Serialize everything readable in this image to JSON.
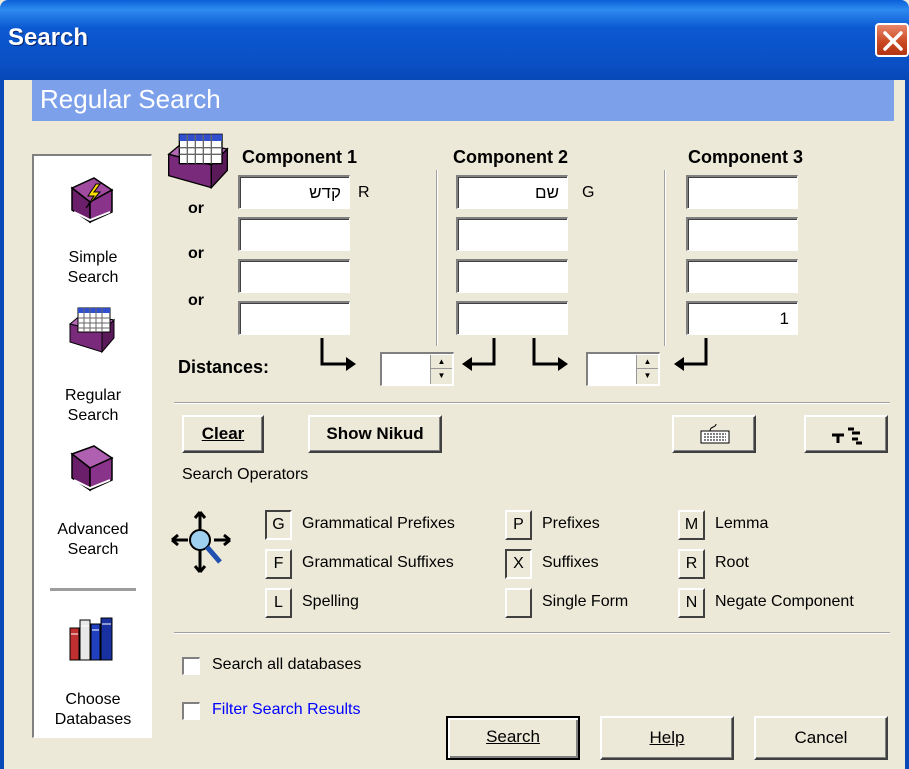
{
  "window": {
    "title": "Search"
  },
  "header": {
    "title": "Regular Search"
  },
  "nav": [
    {
      "label_line1": "Simple",
      "label_line2": "Search",
      "icon": "lightning-book-icon"
    },
    {
      "label_line1": "Regular",
      "label_line2": "Search",
      "icon": "grid-book-icon"
    },
    {
      "label_line1": "Advanced",
      "label_line2": "Search",
      "icon": "purple-book-icon"
    },
    {
      "label_line1": "Choose",
      "label_line2": "Databases",
      "icon": "books-icon"
    }
  ],
  "components": [
    {
      "title": "Component 1",
      "fields": [
        "קדש",
        "",
        "",
        ""
      ],
      "tag": "R"
    },
    {
      "title": "Component 2",
      "fields": [
        "שם",
        "",
        "",
        ""
      ],
      "tag": "G"
    },
    {
      "title": "Component 3",
      "fields": [
        "",
        "",
        "",
        "1"
      ],
      "tag": ""
    }
  ],
  "or_label": "or",
  "distances": {
    "label": "Distances:",
    "value1": "",
    "value2": ""
  },
  "toolbar": {
    "clear": "Clear",
    "show_nikud": "Show Nikud"
  },
  "operators": {
    "title": "Search Operators",
    "items": [
      {
        "key": "G",
        "label": "Grammatical Prefixes",
        "pressed": true
      },
      {
        "key": "F",
        "label": "Grammatical Suffixes",
        "pressed": false
      },
      {
        "key": "L",
        "label": "Spelling",
        "pressed": false
      },
      {
        "key": "P",
        "label": "Prefixes",
        "pressed": false
      },
      {
        "key": "X",
        "label": "Suffixes",
        "pressed": false
      },
      {
        "key": "",
        "label": "Single Form",
        "pressed": false
      },
      {
        "key": "M",
        "label": "Lemma",
        "pressed": false
      },
      {
        "key": "R",
        "label": "Root",
        "pressed": false
      },
      {
        "key": "N",
        "label": "Negate Component",
        "pressed": false
      }
    ]
  },
  "options": {
    "search_all": "Search all databases",
    "filter": "Filter Search Results"
  },
  "actions": {
    "search": "Search",
    "help": "Help",
    "cancel": "Cancel"
  },
  "colors": {
    "title_bar": "#0A4FC4",
    "header_band": "#7CA0EA",
    "face": "#ECE9D8",
    "link": "#0000FF"
  }
}
